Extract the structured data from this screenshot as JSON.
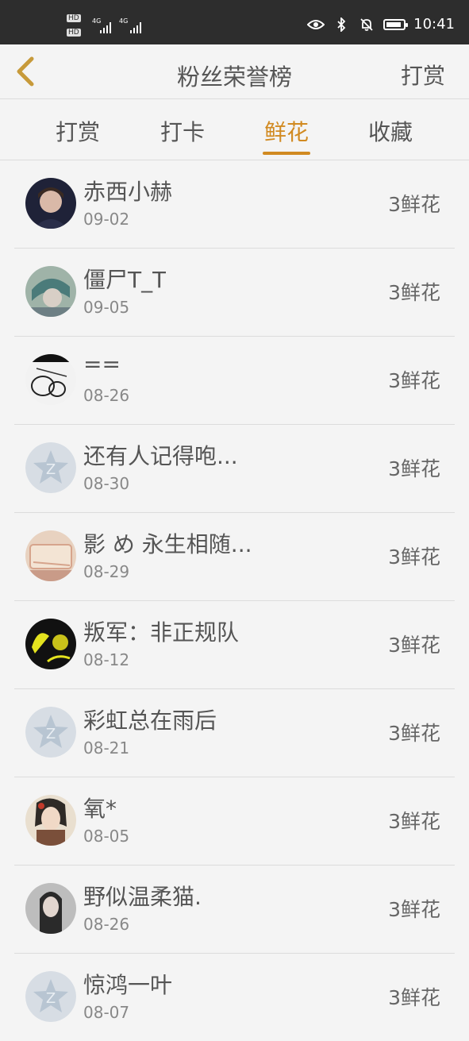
{
  "status_bar": {
    "hd1": "HD",
    "hd2": "HD",
    "net1": "4G",
    "net2": "4G",
    "time": "10:41"
  },
  "nav": {
    "title": "粉丝荣誉榜",
    "action_label": "打赏",
    "back_icon": "chevron-left-icon"
  },
  "tabs": [
    {
      "label": "打赏"
    },
    {
      "label": "打卡"
    },
    {
      "label": "鲜花",
      "active": true
    },
    {
      "label": "收藏"
    }
  ],
  "fans": [
    {
      "name": "赤西小赫",
      "date": "09-02",
      "amount": "3鲜花",
      "avatar": "photo"
    },
    {
      "name": "僵尸T_T",
      "date": "09-05",
      "amount": "3鲜花",
      "avatar": "photo"
    },
    {
      "name": "==",
      "date": "08-26",
      "amount": "3鲜花",
      "avatar": "sketch"
    },
    {
      "name": "还有人记得咆...",
      "date": "08-30",
      "amount": "3鲜花",
      "avatar": "default"
    },
    {
      "name": "影 め 永生相随...",
      "date": "08-29",
      "amount": "3鲜花",
      "avatar": "photo"
    },
    {
      "name": "叛军：非正规队",
      "date": "08-12",
      "amount": "3鲜花",
      "avatar": "photo"
    },
    {
      "name": "彩虹总在雨后",
      "date": "08-21",
      "amount": "3鲜花",
      "avatar": "default"
    },
    {
      "name": "氧*",
      "date": "08-05",
      "amount": "3鲜花",
      "avatar": "photo"
    },
    {
      "name": "野似温柔猫.",
      "date": "08-26",
      "amount": "3鲜花",
      "avatar": "photo"
    },
    {
      "name": "惊鸿一叶",
      "date": "08-07",
      "amount": "3鲜花",
      "avatar": "default"
    }
  ],
  "colors": {
    "accent": "#d18a21",
    "background": "#f4f4f4",
    "status_bar": "#2d2d2d"
  }
}
